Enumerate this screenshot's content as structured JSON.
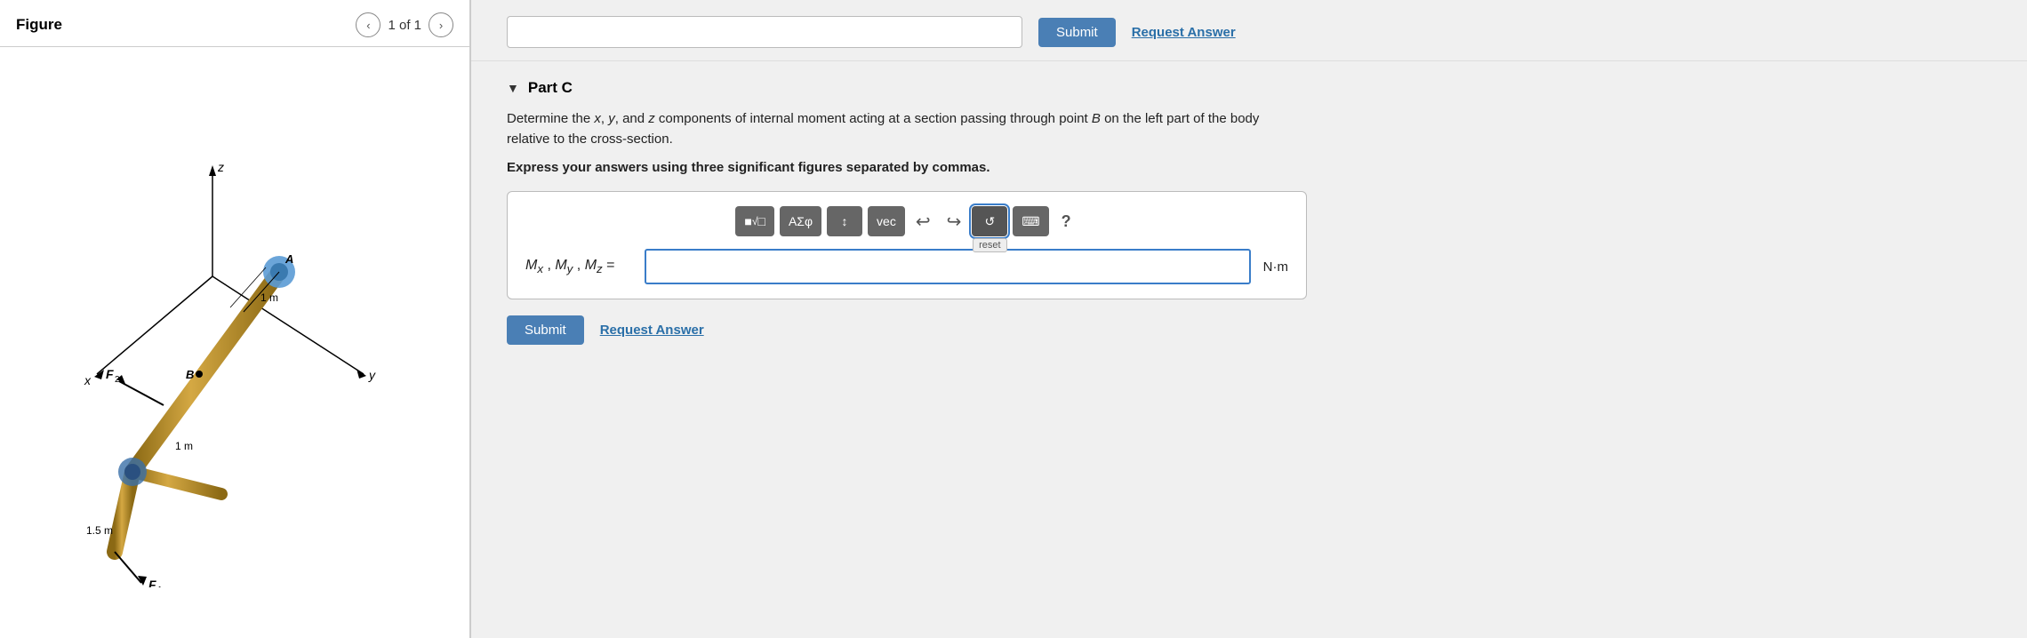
{
  "left": {
    "figure_title": "Figure",
    "nav_count": "1 of 1",
    "nav_prev_label": "‹",
    "nav_next_label": "›"
  },
  "top_bar": {
    "submit_label": "Submit",
    "request_label": "Request Answer"
  },
  "part_c": {
    "arrow": "▼",
    "label": "Part C",
    "description_1": "Determine the ",
    "description_vars": "x, y, and z",
    "description_2": " components of internal moment acting at a section passing through point ",
    "description_point": "B",
    "description_3": " on the left part of the body relative to the cross-section.",
    "instruction": "Express your answers using three significant figures separated by commas.",
    "toolbar": {
      "btn1": "■√□",
      "btn2": "ΑΣφ",
      "btn3": "↕",
      "btn4": "vec",
      "undo_icon": "↩",
      "redo_icon": "↪",
      "reset_label": "reset",
      "keyboard_icon": "⌨",
      "help_label": "?"
    },
    "answer_label": "Mx , My , Mz =",
    "answer_unit": "N·m",
    "submit_label": "Submit",
    "request_label": "Request Answer"
  }
}
